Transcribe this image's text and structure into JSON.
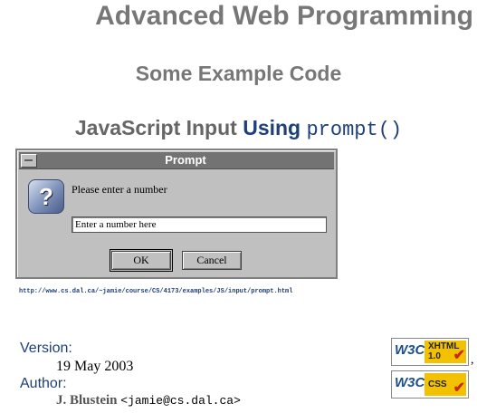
{
  "page": {
    "title": "Advanced Web Programming",
    "subtitle": "Some Example Code",
    "section": {
      "prefix": "JavaScript Input",
      "using": "Using",
      "code": "prompt()"
    }
  },
  "dialog": {
    "title": "Prompt",
    "message": "Please enter a number",
    "input_value": "Enter a number here",
    "ok_label": "OK",
    "cancel_label": "Cancel",
    "icon": "question-icon"
  },
  "url": "http://www.cs.dal.ca/~jamie/course/CS/4173/examples/JS/input/prompt.html",
  "meta": {
    "version_label": "Version:",
    "version_value": "19 May 2003",
    "author_label": "Author:",
    "author_name": "J. Blustein",
    "author_email": "<jamie@cs.dal.ca>"
  },
  "badges": {
    "xhtml": {
      "w3c": "W3C",
      "line1": "XHTML",
      "line2": "1.0"
    },
    "css": {
      "w3c": "W3C",
      "line1": "CSS"
    },
    "separator": ","
  },
  "colors": {
    "heading_gray": "#777777",
    "link_blue": "#1f3f7a",
    "dialog_gray": "#c0c0c0",
    "titlebar": "#737373",
    "badge_yellow": "#f2c200",
    "check_red": "#c8281e"
  }
}
